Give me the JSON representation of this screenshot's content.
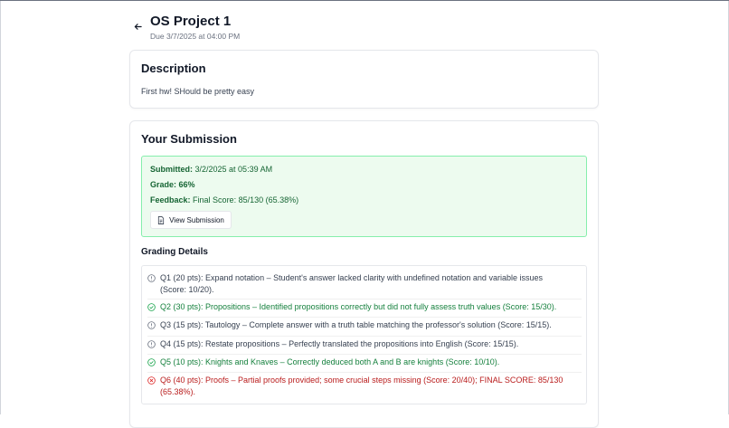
{
  "assignment": {
    "title": "OS Project 1",
    "due": "Due 3/7/2025 at 04:00 PM"
  },
  "description": {
    "heading": "Description",
    "text": "First hw! SHould be pretty easy"
  },
  "submission": {
    "heading": "Your Submission",
    "submitted_label": "Submitted:",
    "submitted_value": "3/2/2025 at 05:39 AM",
    "grade_label": "Grade:",
    "grade_value": "66%",
    "feedback_label": "Feedback:",
    "feedback_value": "Final Score: 85/130 (65.38%)",
    "view_button": "View Submission"
  },
  "grading": {
    "heading": "Grading Details",
    "items": [
      {
        "status": "neutral",
        "icon": "info-icon",
        "text": "Q1 (20 pts): Expand notation – Student's answer lacked clarity with undefined notation and variable issues (Score: 10/20)."
      },
      {
        "status": "good",
        "icon": "check-circle-icon",
        "text": "Q2 (30 pts): Propositions – Identified propositions correctly but did not fully assess truth values (Score: 15/30)."
      },
      {
        "status": "neutral",
        "icon": "info-icon",
        "text": "Q3 (15 pts): Tautology – Complete answer with a truth table matching the professor's solution (Score: 15/15)."
      },
      {
        "status": "neutral",
        "icon": "info-icon",
        "text": "Q4 (15 pts): Restate propositions – Perfectly translated the propositions into English (Score: 15/15)."
      },
      {
        "status": "good",
        "icon": "check-circle-icon",
        "text": "Q5 (10 pts): Knights and Knaves – Correctly deduced both A and B are knights (Score: 10/10)."
      },
      {
        "status": "bad",
        "icon": "x-circle-icon",
        "text": "Q6 (40 pts): Proofs – Partial proofs provided; some crucial steps missing (Score: 20/40); FINAL SCORE: 85/130 (65.38%)."
      }
    ]
  },
  "colors": {
    "success_bg": "#edfbef",
    "success_border": "#86efac",
    "success_text": "#166534",
    "good_text": "#15803d",
    "bad_text": "#b91c1c"
  }
}
